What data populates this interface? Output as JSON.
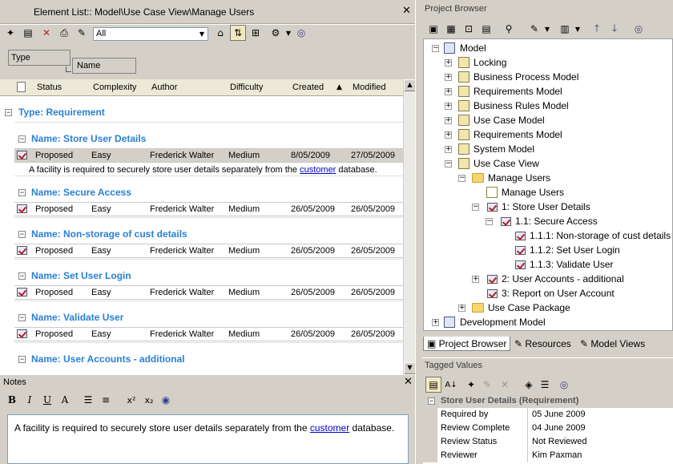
{
  "element_list": {
    "title": "Element List:: Model\\Use Case View\\Manage Users",
    "close": "✕",
    "filter_value": "All",
    "group_by": [
      "Type",
      "Name"
    ],
    "columns": [
      "Status",
      "Complexity",
      "Author",
      "Difficulty",
      "Created",
      "Modified"
    ],
    "type_group": "Type: Requirement",
    "groups": [
      {
        "name": "Name: Store User Details",
        "row": {
          "status": "Proposed",
          "complexity": "Easy",
          "author": "Frederick Walter",
          "difficulty": "Medium",
          "created": "8/05/2009",
          "modified": "27/05/2009"
        },
        "note_before": "A facility is required to securely store user details separately from the ",
        "note_link": "customer",
        "note_after": " database."
      },
      {
        "name": "Name: Secure Access",
        "row": {
          "status": "Proposed",
          "complexity": "Easy",
          "author": "Frederick Walter",
          "difficulty": "Medium",
          "created": "26/05/2009",
          "modified": "26/05/2009"
        }
      },
      {
        "name": "Name: Non-storage of cust details",
        "row": {
          "status": "Proposed",
          "complexity": "Easy",
          "author": "Frederick Walter",
          "difficulty": "Medium",
          "created": "26/05/2009",
          "modified": "26/05/2009"
        }
      },
      {
        "name": "Name: Set User Login",
        "row": {
          "status": "Proposed",
          "complexity": "Easy",
          "author": "Frederick Walter",
          "difficulty": "Medium",
          "created": "26/05/2009",
          "modified": "26/05/2009"
        }
      },
      {
        "name": "Name: Validate User",
        "row": {
          "status": "Proposed",
          "complexity": "Easy",
          "author": "Frederick Walter",
          "difficulty": "Medium",
          "created": "26/05/2009",
          "modified": "26/05/2009"
        }
      },
      {
        "name": "Name: User Accounts - additional"
      }
    ]
  },
  "notes": {
    "title": "Notes",
    "close": "✕",
    "text_before": "A facility is required to securely store user details separately from the ",
    "text_link": "customer",
    "text_after": " database."
  },
  "project_browser": {
    "title": "Project Browser",
    "tree": [
      {
        "label": "Model"
      },
      {
        "label": "Locking"
      },
      {
        "label": "Business Process Model"
      },
      {
        "label": "Requirements Model"
      },
      {
        "label": "Business Rules Model"
      },
      {
        "label": "Use Case Model"
      },
      {
        "label": "Requirements Model"
      },
      {
        "label": "System Model"
      },
      {
        "label": "Use Case View"
      },
      {
        "label": "Manage Users"
      },
      {
        "label": "Manage Users"
      },
      {
        "label": "1: Store User Details"
      },
      {
        "label": "1.1: Secure Access"
      },
      {
        "label": "1.1.1: Non-storage of cust details"
      },
      {
        "label": "1.1.2: Set User Login"
      },
      {
        "label": "1.1.3: Validate User"
      },
      {
        "label": "2: User Accounts - additional"
      },
      {
        "label": "3: Report on User Account"
      },
      {
        "label": "Use Case Package"
      },
      {
        "label": "Development Model"
      }
    ],
    "tabs": [
      "Project Browser",
      "Resources",
      "Model Views"
    ]
  },
  "tagged_values": {
    "title": "Tagged Values",
    "group": "Store User Details (Requirement)",
    "rows": [
      {
        "key": "Required by",
        "value": "05 June 2009"
      },
      {
        "key": "Review Complete",
        "value": "04 June 2009"
      },
      {
        "key": "Review Status",
        "value": "Not Reviewed"
      },
      {
        "key": "Reviewer",
        "value": "Kim Paxman"
      }
    ]
  }
}
